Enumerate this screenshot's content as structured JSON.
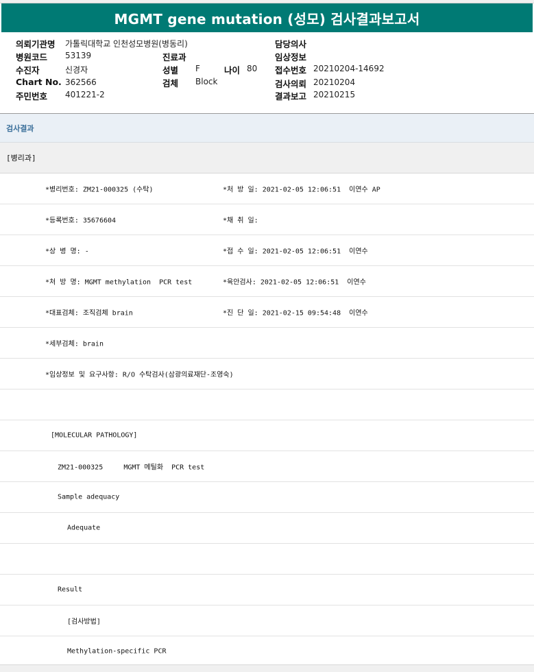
{
  "report": {
    "title": "MGMT gene mutation (성모) 검사결과보고서"
  },
  "info": {
    "institution_label": "의뢰기관명",
    "institution_value": "가톨릭대학교 인천성모병원(병동리)",
    "hospital_code_label": "병원코드",
    "hospital_code_value": "53139",
    "department_label": "진료과",
    "department_value": "",
    "receiver_label": "수진자",
    "receiver_value": "신경자",
    "sex_label": "성별",
    "sex_value": "F",
    "age_label": "나이",
    "age_value": "80",
    "chart_label": "Chart No.",
    "chart_value": "362566",
    "specimen_label": "검체",
    "specimen_value": "Block",
    "resident_label": "주민번호",
    "resident_value": "401221-2",
    "doctor_label": "담당의사",
    "doctor_value": "",
    "clinical_label": "임상정보",
    "clinical_value": "",
    "accession_label": "접수번호",
    "accession_value": "20210204-14692",
    "request_label": "검사의뢰",
    "request_value": "20210204",
    "reportdate_label": "결과보고",
    "reportdate_value": "20210215"
  },
  "results": {
    "section_title": "검사결과",
    "department": "[병리과]",
    "lines": {
      "l1a": "*병리번호: ZM21-000325 (수탁)",
      "l1b": "*처 방 일: 2021-02-05 12:06:51  이연수 AP",
      "l2a": "*등록번호: 35676604",
      "l2b": "*채 취 일:",
      "l3a": "*상 병 명: -",
      "l3b": "*접 수 일: 2021-02-05 12:06:51  이연수",
      "l4a": "*처 방 명: MGMT methylation  PCR test",
      "l4b": "*육안검사: 2021-02-05 12:06:51  이연수",
      "l5a": "*대표검체: 조직검체 brain",
      "l5b": "*진 단 일: 2021-02-15 09:54:48  이연수",
      "l6a": "*세부검체: brain",
      "l7a": "*임상정보 및 요구사항: R/O 수탁검사(삼광의료재단-조영숙)",
      "l9a": "[MOLECULAR PATHOLOGY]",
      "l10a": "ZM21-000325     MGMT 메틸화  PCR test",
      "l11a": "Sample adequacy",
      "l12a": "Adequate",
      "l14a": "Result",
      "l15a": "[검사방법]",
      "l16a": "Methylation-specific PCR"
    }
  },
  "colors": {
    "title_bg": "#007a74",
    "section_text": "#3a6f9a"
  }
}
